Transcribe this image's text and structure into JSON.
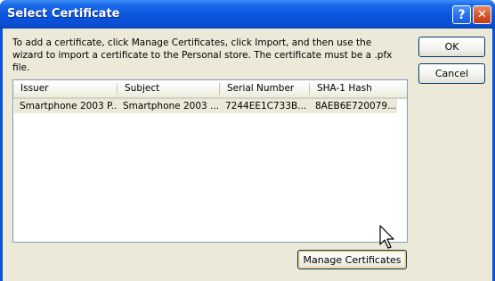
{
  "window": {
    "title": "Select Certificate",
    "help_glyph": "?",
    "close_glyph": "✕",
    "help_icon": "question-mark-icon",
    "close_icon": "close-icon"
  },
  "instructions": "To add a certificate, click Manage Certificates, click Import, and then use the wizard to import a certificate to the Personal store. The certificate must be a .pfx file.",
  "buttons": {
    "ok": "OK",
    "cancel": "Cancel",
    "manage": "Manage Certificates"
  },
  "list": {
    "columns": [
      "Issuer",
      "Subject",
      "Serial Number",
      "SHA-1 Hash"
    ],
    "rows": [
      [
        "Smartphone 2003 P...",
        "Smartphone 2003 ...",
        "7244EE1C733B...",
        "8AEB6E720079..."
      ]
    ]
  },
  "colors": {
    "titlebar": "#0a55dd",
    "dialog_face": "#ece9d8",
    "close_button": "#c23d16",
    "button_border": "#003c74"
  }
}
